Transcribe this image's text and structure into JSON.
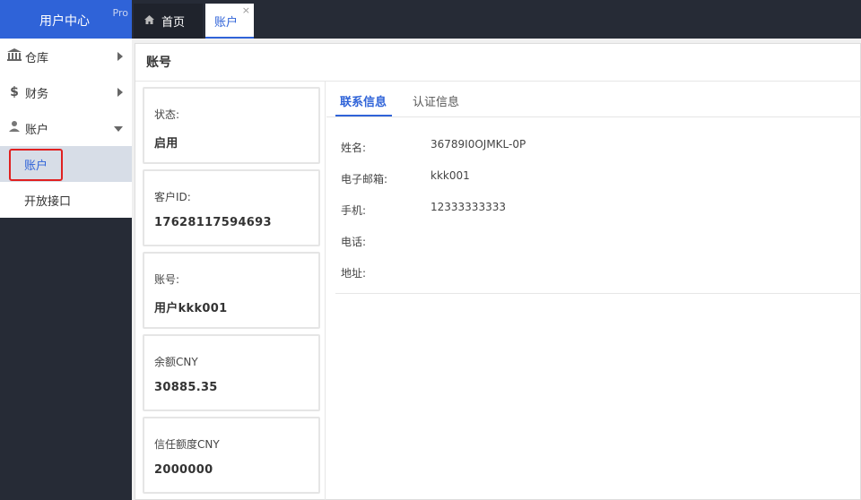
{
  "app": {
    "title": "用户中心",
    "badge": "Pro"
  },
  "sidebar": {
    "items": [
      {
        "label": "仓库",
        "icon": "bank-icon"
      },
      {
        "label": "财务",
        "icon": "dollar-icon"
      },
      {
        "label": "账户",
        "icon": "user-icon"
      }
    ],
    "subitems": [
      {
        "label": "账户",
        "active": true
      },
      {
        "label": "开放接口",
        "active": false
      }
    ]
  },
  "tabs": [
    {
      "label": "首页"
    },
    {
      "label": "账户",
      "close": "×"
    }
  ],
  "page": {
    "title": "账号"
  },
  "cards": [
    {
      "label": "状态:",
      "value": "启用"
    },
    {
      "label": "客户ID:",
      "value": "17628117594693"
    },
    {
      "label": "账号:",
      "value": "用户kkk001"
    },
    {
      "label": "余额CNY",
      "value": "30885.35"
    },
    {
      "label": "信任额度CNY",
      "value": "2000000"
    }
  ],
  "detail_tabs": [
    "联系信息",
    "认证信息"
  ],
  "contact": [
    {
      "label": "姓名:",
      "value": "36789I0OJMKL-0P"
    },
    {
      "label": "电子邮箱:",
      "value": "kkk001"
    },
    {
      "label": "手机:",
      "value": "12333333333"
    },
    {
      "label": "电话:",
      "value": ""
    },
    {
      "label": "地址:",
      "value": ""
    }
  ],
  "colors": {
    "accent": "#2f63d8",
    "sidebar": "#262b36",
    "highlight": "#e02020"
  }
}
